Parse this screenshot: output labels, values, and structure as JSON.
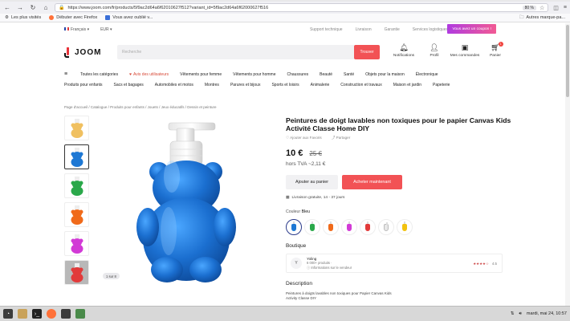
{
  "browser": {
    "url": "https://www.joom.com/fr/products/5f9ac2d64a6f62010627f512?variant_id=5f9ac2d64a6f62000627f516",
    "zoom": "80 %",
    "bookmarks": [
      "Les plus visités",
      "Débuter avec Firefox",
      "Vous avez oublié v...",
      "Autres marque-pa..."
    ]
  },
  "site": {
    "top": {
      "language": "Français",
      "currency": "EUR",
      "links": [
        "Support technique",
        "Livraison",
        "Garantie",
        "Services logistiques"
      ],
      "coupon": "Vous avez un coupon !"
    },
    "logo": "JOOM",
    "search_placeholder": "Recherche",
    "search_button": "Trouver",
    "header_icons": [
      {
        "label": "Notifications",
        "icon": "bell-icon"
      },
      {
        "label": "Profil",
        "icon": "user-icon"
      },
      {
        "label": "Mes commandes",
        "icon": "box-icon"
      },
      {
        "label": "Panier",
        "icon": "cart-icon",
        "badge": "1"
      }
    ],
    "categories_row1": [
      "Toutes les catégories",
      "Avis des utilisateurs",
      "Vêtements pour femme",
      "Vêtements pour homme",
      "Chaussures",
      "Beauté",
      "Santé",
      "Objets pour la maison",
      "Électronique"
    ],
    "categories_row2": [
      "Produits pour enfants",
      "Sacs et bagages",
      "Automobiles et motos",
      "Montres",
      "Parures et bijoux",
      "Sports et loisirs",
      "Animalerie",
      "Construction et travaux",
      "Maison et jardin",
      "Papeterie"
    ],
    "breadcrumb": "Page d'accueil / Catalogue / Produits pour enfants / Jouets / Jeux éducatifs / Dessin et peinture"
  },
  "product": {
    "title": "Peintures de doigt lavables non toxiques pour le papier Canvas Kids Activité Classe Home DIY",
    "favorite": "Ajouter aux Favoris",
    "share": "Partager",
    "price": "10 €",
    "old_price": "25 €",
    "tva": "hors TVA ~2,11 €",
    "add_to_cart": "Ajouter au panier",
    "buy_now": "Acheter maintenant",
    "delivery": "Livraison gratuite, 14 - 37 jours",
    "color_label": "Couleur",
    "color_value": "Bleu",
    "image_badge": "1 sur 8",
    "swatches": [
      "#1e78d4",
      "#2aa84a",
      "#f06a1a",
      "#d23ad6",
      "#e23a3a",
      "#e8e8e8",
      "#f2c20e"
    ],
    "thumb_colors": [
      "#f0c060",
      "#1e78d4",
      "#2aa84a",
      "#f06a1a",
      "#d23ad6",
      "#e23a3a"
    ],
    "boutique_label": "Boutique",
    "shop": {
      "avatar": "Y",
      "name": "Yoling",
      "products": "6 000+ produits ·",
      "info": "Informations sur le vendeur",
      "rating": "4.5"
    },
    "description_label": "Description",
    "description": "Peintures à doigts lavables non toxiques pour Papier Canvas Kids Activity Classe DIY"
  },
  "taskbar": {
    "clock": "mardi, mai 24, 10:57"
  }
}
